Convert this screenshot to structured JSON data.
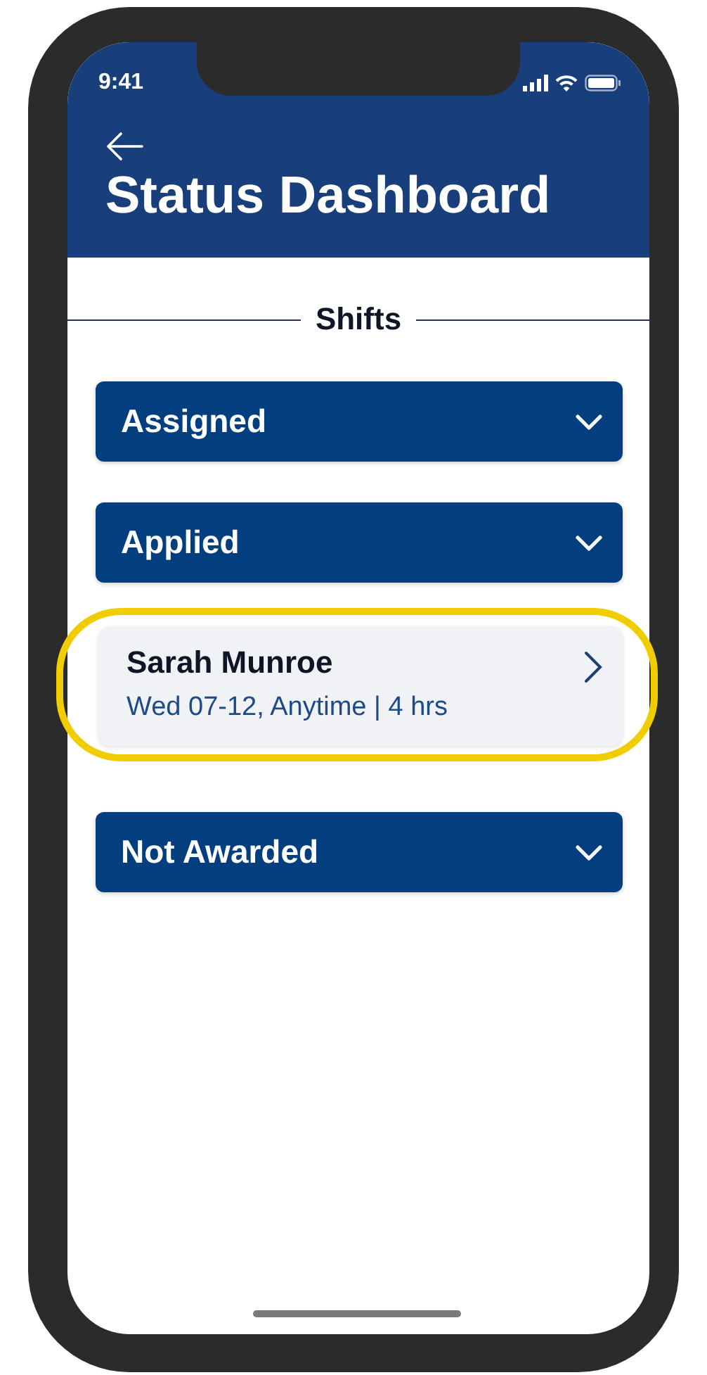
{
  "status_bar": {
    "time": "9:41"
  },
  "header": {
    "title": "Status Dashboard"
  },
  "section_title": "Shifts",
  "items": [
    {
      "kind": "accordion",
      "label": "Assigned",
      "expanded": false
    },
    {
      "kind": "accordion",
      "label": "Applied",
      "expanded": false
    },
    {
      "kind": "shift",
      "name": "Sarah Munroe",
      "details": "Wed 07-12, Anytime | 4 hrs",
      "highlighted": true
    },
    {
      "kind": "accordion",
      "label": "Not Awarded",
      "expanded": false
    }
  ]
}
